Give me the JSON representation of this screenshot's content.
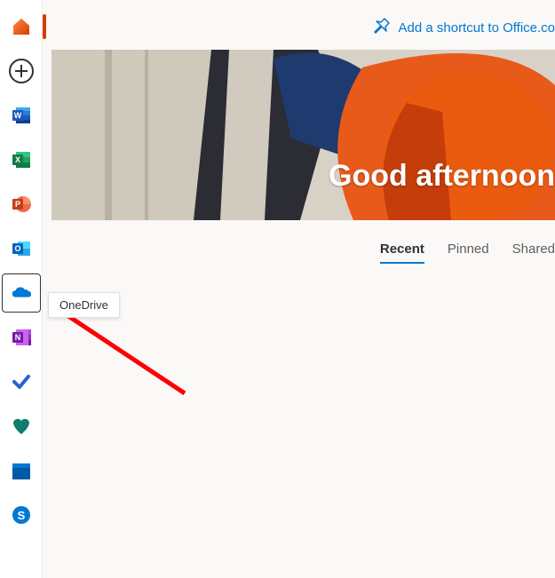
{
  "sidebar": {
    "items": [
      {
        "name": "home",
        "label": "Home"
      },
      {
        "name": "create",
        "label": "Create"
      },
      {
        "name": "word",
        "label": "Word"
      },
      {
        "name": "excel",
        "label": "Excel"
      },
      {
        "name": "powerpoint",
        "label": "PowerPoint"
      },
      {
        "name": "outlook",
        "label": "Outlook"
      },
      {
        "name": "onedrive",
        "label": "OneDrive"
      },
      {
        "name": "onenote",
        "label": "OneNote"
      },
      {
        "name": "todo",
        "label": "To Do"
      },
      {
        "name": "family",
        "label": "Family Safety"
      },
      {
        "name": "calendar",
        "label": "Calendar"
      },
      {
        "name": "skype",
        "label": "Skype"
      }
    ]
  },
  "tooltip": {
    "text": "OneDrive"
  },
  "header": {
    "shortcut_label": "Add a shortcut to Office.co"
  },
  "hero": {
    "greeting": "Good afternoon"
  },
  "tabs": {
    "recent": "Recent",
    "pinned": "Pinned",
    "shared": "Shared"
  }
}
